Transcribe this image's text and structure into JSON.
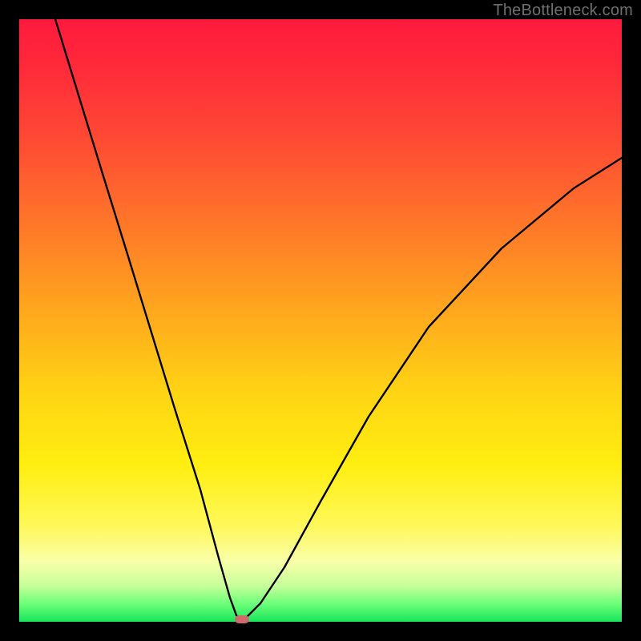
{
  "watermark": "TheBottleneck.com",
  "colors": {
    "frame": "#000000",
    "gradient_top": "#ff1a3d",
    "gradient_mid": "#ffd414",
    "gradient_bottom": "#18e55a",
    "curve": "#000000",
    "marker": "#cf6a6a",
    "watermark_text": "#6f6f6f"
  },
  "chart_data": {
    "type": "line",
    "title": "",
    "xlabel": "",
    "ylabel": "",
    "xlim": [
      0,
      100
    ],
    "ylim": [
      0,
      100
    ],
    "background": "vertical-gradient red→orange→yellow→green (bottleneck heatmap)",
    "marker": {
      "x": 37,
      "y": 0,
      "shape": "rounded-pill",
      "color": "#cf6a6a"
    },
    "series": [
      {
        "name": "bottleneck-curve",
        "x": [
          6,
          10,
          14,
          18,
          22,
          26,
          30,
          33,
          35,
          36,
          37,
          38,
          40,
          44,
          50,
          58,
          68,
          80,
          92,
          100
        ],
        "y": [
          100,
          87,
          74,
          61,
          48,
          35,
          22,
          11,
          4,
          1,
          0,
          1,
          3,
          9,
          20,
          34,
          49,
          62,
          72,
          77
        ]
      }
    ],
    "notes": "No axis ticks or numeric labels are visible; x and y values are estimated from pixel position on a 0–100 normalized scale. Curve minimum (bottleneck sweet spot) is at x≈37, y≈0."
  }
}
